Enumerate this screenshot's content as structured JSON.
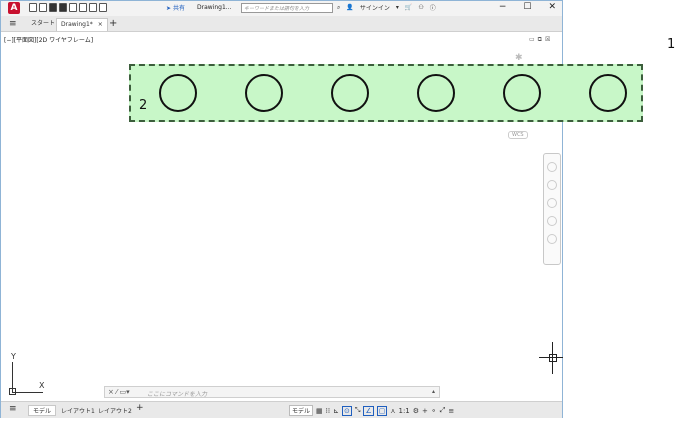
{
  "titlebar": {
    "app_icon": "A",
    "share_label": "共有",
    "doc_title": "Drawing1...",
    "search_placeholder": "キーワードまたは語句を入力",
    "signin_label": "サインイン",
    "controls": [
      "−",
      "☐",
      "✕"
    ]
  },
  "tabs": {
    "menu_icon": "≡",
    "start_label": "スタート",
    "active_label": "Drawing1*",
    "close_label": "×",
    "add_label": "+"
  },
  "viewport": {
    "label": "[−][平面図][2D ワイヤフレーム]",
    "controls": [
      "▭",
      "⧉",
      "☒"
    ],
    "wcs_label": "WCS",
    "ucs_x": "X",
    "ucs_y": "Y"
  },
  "command": {
    "icons": "× ⁄ ▭▾",
    "placeholder": "ここにコマンドを入力",
    "arrow": "▴"
  },
  "status": {
    "menu_icon": "≡",
    "model_tab": "モデル",
    "layout1_tab": "レイアウト1",
    "layout2_tab": "レイアウト2",
    "add_tab": "+",
    "model_button": "モデル",
    "scale": "1:1"
  },
  "overlay": {
    "label_1": "1",
    "label_2": "2",
    "circle_count": 6
  }
}
